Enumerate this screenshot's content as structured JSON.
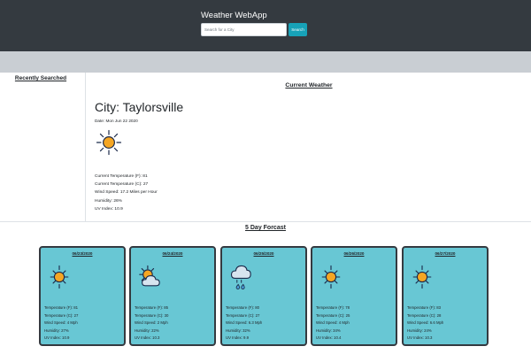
{
  "header": {
    "title": "Weather WebApp",
    "search_placeholder": "Search for a City",
    "search_value": "",
    "search_label": "Search"
  },
  "sidebar": {
    "title": "Recently Searched"
  },
  "current": {
    "title": "Current Weather",
    "city_label": "City: ",
    "city": "Taylorsville",
    "date_label": "Date: ",
    "date": "Mon Jun 22 2020",
    "icon": "sun-icon",
    "temp_f_label": "Current Temperature (F): ",
    "temp_f": "81",
    "temp_c_label": "Current Temperature (C): ",
    "temp_c": "27",
    "wind_label": "Wind Speed: ",
    "wind": "17.2 Miles per Hour",
    "humidity_label": "Humidity: ",
    "humidity": "26%",
    "uv_label": "UV Index: ",
    "uv": "10.9"
  },
  "forecast": {
    "title": "5 Day Forcast",
    "days": [
      {
        "date": "06/23/2020",
        "icon": "sun-icon",
        "temp_f": "Temperature (F): 81",
        "temp_c": "Temperature (C): 27",
        "wind": "Wind Speed: 4 Mph",
        "humidity": "Humidity: 27%",
        "uv": "UV Index: 10.9"
      },
      {
        "date": "06/24/2020",
        "icon": "partly-cloudy-icon",
        "temp_f": "Temperature (F): 85",
        "temp_c": "Temperature (C): 30",
        "wind": "Wind Speed: 2 Mph",
        "humidity": "Humidity: 22%",
        "uv": "UV Index: 10.3"
      },
      {
        "date": "06/25/2020",
        "icon": "cloud-rain-icon",
        "temp_f": "Temperature (F): 80",
        "temp_c": "Temperature (C): 27",
        "wind": "Wind Speed: 6.3 Mph",
        "humidity": "Humidity: 32%",
        "uv": "UV Index: 9.9"
      },
      {
        "date": "06/26/2020",
        "icon": "sun-icon",
        "temp_f": "Temperature (F): 78",
        "temp_c": "Temperature (C): 25",
        "wind": "Wind Speed: 4 Mph",
        "humidity": "Humidity: 34%",
        "uv": "UV Index: 10.4"
      },
      {
        "date": "06/27/2020",
        "icon": "sun-icon",
        "temp_f": "Temperature (F): 83",
        "temp_c": "Temperature (C): 28",
        "wind": "Wind Speed: 6.6 Mph",
        "humidity": "Humidity: 24%",
        "uv": "UV Index: 10.3"
      }
    ]
  },
  "colors": {
    "navbar": "#343a40",
    "band": "#c9ced3",
    "card_bg": "#68c7d4",
    "button": "#17a2b8",
    "sun": "#f5a623",
    "sun_outline": "#1b2a4a",
    "cloud": "#d7e4ef"
  }
}
